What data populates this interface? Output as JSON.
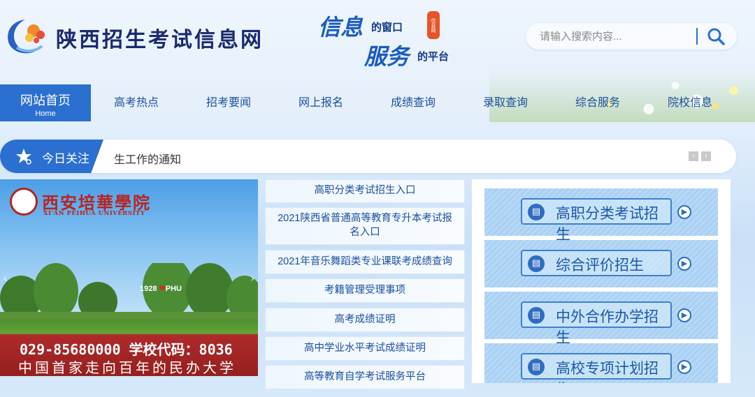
{
  "header": {
    "site_title": "陕西招生考试信息网",
    "slogan": {
      "word1": "信息",
      "word1_suffix": "的窗口",
      "word2": "服务",
      "word2_suffix": "的平台",
      "seal": "信息网"
    },
    "search": {
      "placeholder": "请输入搜索内容..."
    }
  },
  "nav": {
    "items": [
      {
        "label": "网站首页",
        "sub": "Home"
      },
      {
        "label": "高考热点"
      },
      {
        "label": "招考要闻"
      },
      {
        "label": "网上报名"
      },
      {
        "label": "成绩查询"
      },
      {
        "label": "录取查询"
      },
      {
        "label": "综合服务"
      },
      {
        "label": "院校信息"
      }
    ]
  },
  "ticker": {
    "label": "今日关注",
    "text": "生工作的通知",
    "prev": "‹",
    "next": "›"
  },
  "banner": {
    "school_cn": "西安培華學院",
    "school_en": "XI'AN PEIHUA UNIVERSITY",
    "sign_year": "1928",
    "sign_heart": "❤",
    "sign_text": "PHU",
    "phone": "029-85680000 学校代码：8036",
    "motto": "中国首家走向百年的民办大学"
  },
  "links": [
    "高职分类考试招生入口",
    "2021陕西省普通高等教育专升本考试报名入口",
    "2021年音乐舞蹈类专业课联考成绩查询",
    "考籍管理受理事项",
    "高考成绩证明",
    "高中学业水平考试成绩证明",
    "高等教育自学考试服务平台"
  ],
  "enroll": [
    "高职分类考试招生",
    "综合评价招生",
    "中外合作办学招生",
    "高校专项计划招生"
  ],
  "colors": {
    "primary": "#2b6fd0",
    "title": "#1b2a6e",
    "banner_red": "#b02a2a"
  }
}
